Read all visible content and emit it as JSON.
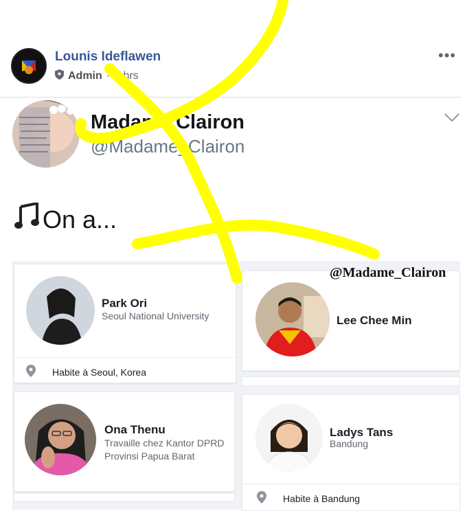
{
  "post": {
    "poster_name": "Lounis Ideflawen",
    "role": "Admin",
    "separator": "·",
    "time": "5 hrs",
    "icons": {
      "more": "more-dots-icon",
      "role": "shield-icon"
    }
  },
  "embed": {
    "name": "Madame Clairon",
    "handle": "@Madame_Clairon",
    "text": "On a...",
    "icons": {
      "note": "music-note-icon",
      "expand": "chevron-down-icon"
    }
  },
  "watermark": "@Madame_Clairon",
  "people": [
    {
      "name": "Park Ori",
      "subtitle_1": "Seoul National University",
      "subtitle_2": "",
      "location": "Habite à Seoul, Korea"
    },
    {
      "name": "Lee Chee Min",
      "subtitle_1": "",
      "subtitle_2": "",
      "location": ""
    },
    {
      "name": "Ona Thenu",
      "subtitle_1": "Travaille chez Kantor DPRD",
      "subtitle_2": "Provinsi Papua Barat",
      "location": ""
    },
    {
      "name": "Ladys Tans",
      "subtitle_1": "Bandung",
      "subtitle_2": "",
      "location": "Habite à Bandung"
    }
  ],
  "colors": {
    "link": "#385898",
    "scribble": "#ffff00",
    "meta": "#606770"
  }
}
